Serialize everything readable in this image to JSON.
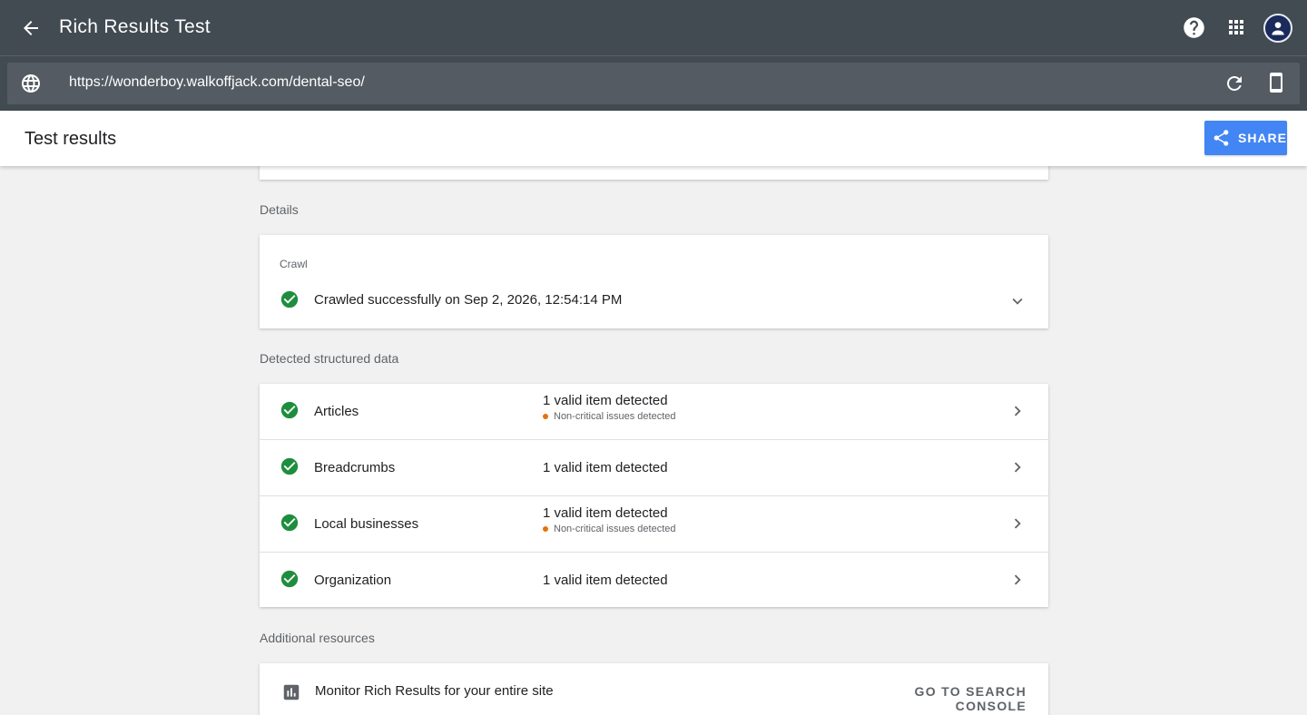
{
  "app": {
    "title": "Rich Results Test"
  },
  "urlbar": {
    "url": "https://wonderboy.walkoffjack.com/dental-seo/"
  },
  "results": {
    "title": "Test results",
    "share_label": "SHARE"
  },
  "details": {
    "section_label": "Details",
    "crawl_label": "Crawl",
    "crawl_status": "Crawled successfully on Sep 2, 2026, 12:54:14 PM"
  },
  "structured_data": {
    "section_label": "Detected structured data",
    "items": [
      {
        "name": "Articles",
        "valid": "1 valid item detected",
        "issue": "Non-critical issues detected"
      },
      {
        "name": "Breadcrumbs",
        "valid": "1 valid item detected",
        "issue": ""
      },
      {
        "name": "Local businesses",
        "valid": "1 valid item detected",
        "issue": "Non-critical issues detected"
      },
      {
        "name": "Organization",
        "valid": "1 valid item detected",
        "issue": ""
      }
    ]
  },
  "resources": {
    "section_label": "Additional resources",
    "monitor_text": "Monitor Rich Results for your entire site",
    "console_label": "GO TO SEARCH CONSOLE"
  },
  "colors": {
    "header_bg": "#424a52",
    "accent": "#4285f4",
    "success": "#1e8e3e",
    "warning_dot": "#e8710a"
  },
  "icons": {
    "back": "arrow-back-icon",
    "help": "help-icon",
    "apps": "apps-grid-icon",
    "globe": "globe-icon",
    "refresh": "refresh-icon",
    "device": "smartphone-icon",
    "share": "share-icon",
    "check": "check-circle-icon",
    "chevron": "chevron-right-icon",
    "expand": "chevron-down-icon",
    "console": "bar-chart-icon"
  }
}
